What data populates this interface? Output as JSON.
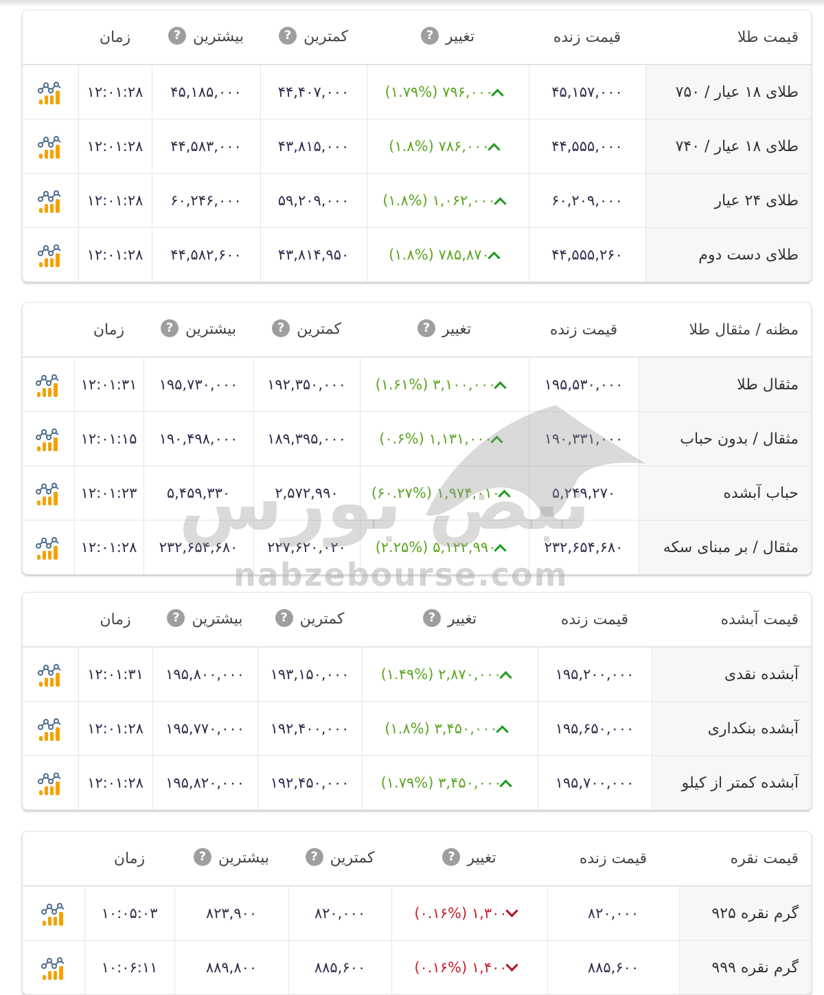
{
  "headers": {
    "live_price": "قیمت زنده",
    "change": "تغییر",
    "lowest": "کمترین",
    "highest": "بیشترین",
    "time": "زمان",
    "help_glyph": "?"
  },
  "watermark": {
    "site": "nabzebourse.com",
    "logo_text": "نبض بورس"
  },
  "colors": {
    "up": "#5aa51e",
    "down": "#c81e2a",
    "chart_icon_bars": "#f5a100",
    "chart_icon_line": "#4a6a8a"
  },
  "sections": [
    {
      "title": "قیمت طلا",
      "rows": [
        {
          "name": "طلای ۱۸ عیار / ۷۵۰",
          "live": "۴۵,۱۵۷,۰۰۰",
          "change": "۷۹۶,۰۰۰ (۱.۷۹%)",
          "direction": "up",
          "low": "۴۴,۴۰۷,۰۰۰",
          "high": "۴۵,۱۸۵,۰۰۰",
          "time": "۱۲:۰۱:۲۸"
        },
        {
          "name": "طلای ۱۸ عیار / ۷۴۰",
          "live": "۴۴,۵۵۵,۰۰۰",
          "change": "۷۸۶,۰۰۰ (۱.۸%)",
          "direction": "up",
          "low": "۴۳,۸۱۵,۰۰۰",
          "high": "۴۴,۵۸۳,۰۰۰",
          "time": "۱۲:۰۱:۲۸"
        },
        {
          "name": "طلای ۲۴ عیار",
          "live": "۶۰,۲۰۹,۰۰۰",
          "change": "۱,۰۶۲,۰۰۰ (۱.۸%)",
          "direction": "up",
          "low": "۵۹,۲۰۹,۰۰۰",
          "high": "۶۰,۲۴۶,۰۰۰",
          "time": "۱۲:۰۱:۲۸"
        },
        {
          "name": "طلای دست دوم",
          "live": "۴۴,۵۵۵,۲۶۰",
          "change": "۷۸۵,۸۷۰ (۱.۸%)",
          "direction": "up",
          "low": "۴۳,۸۱۴,۹۵۰",
          "high": "۴۴,۵۸۲,۶۰۰",
          "time": "۱۲:۰۱:۲۸"
        }
      ]
    },
    {
      "title": "مظنه / مثقال طلا",
      "rows": [
        {
          "name": "مثقال طلا",
          "live": "۱۹۵,۵۳۰,۰۰۰",
          "change": "۳,۱۰۰,۰۰۰ (۱.۶۱%)",
          "direction": "up",
          "low": "۱۹۲,۳۵۰,۰۰۰",
          "high": "۱۹۵,۷۳۰,۰۰۰",
          "time": "۱۲:۰۱:۳۱"
        },
        {
          "name": "مثقال / بدون حباب",
          "live": "۱۹۰,۳۳۱,۰۰۰",
          "change": "۱,۱۳۱,۰۰۰ (۰.۶%)",
          "direction": "up",
          "low": "۱۸۹,۳۹۵,۰۰۰",
          "high": "۱۹۰,۴۹۸,۰۰۰",
          "time": "۱۲:۰۱:۱۵"
        },
        {
          "name": "حباب آبشده",
          "live": "۵,۲۴۹,۲۷۰",
          "change": "۱,۹۷۴,۰۱۰ (۶۰.۲۷%)",
          "direction": "up",
          "low": "۲,۵۷۲,۹۹۰",
          "high": "۵,۴۵۹,۳۳۰",
          "time": "۱۲:۰۱:۲۳"
        },
        {
          "name": "مثقال / بر مبنای سکه",
          "live": "۲۳۲,۶۵۴,۶۸۰",
          "change": "۵,۱۲۲,۹۹۰ (۲.۲۵%)",
          "direction": "up",
          "low": "۲۲۷,۶۲۰,۰۲۰",
          "high": "۲۳۲,۶۵۴,۶۸۰",
          "time": "۱۲:۰۱:۲۸"
        }
      ]
    },
    {
      "title": "قیمت آبشده",
      "rows": [
        {
          "name": "آبشده نقدی",
          "live": "۱۹۵,۲۰۰,۰۰۰",
          "change": "۲,۸۷۰,۰۰۰ (۱.۴۹%)",
          "direction": "up",
          "low": "۱۹۳,۱۵۰,۰۰۰",
          "high": "۱۹۵,۸۰۰,۰۰۰",
          "time": "۱۲:۰۱:۳۱"
        },
        {
          "name": "آبشده بنکداری",
          "live": "۱۹۵,۶۵۰,۰۰۰",
          "change": "۳,۴۵۰,۰۰۰ (۱.۸%)",
          "direction": "up",
          "low": "۱۹۲,۴۰۰,۰۰۰",
          "high": "۱۹۵,۷۷۰,۰۰۰",
          "time": "۱۲:۰۱:۲۸"
        },
        {
          "name": "آبشده کمتر از کیلو",
          "live": "۱۹۵,۷۰۰,۰۰۰",
          "change": "۳,۴۵۰,۰۰۰ (۱.۷۹%)",
          "direction": "up",
          "low": "۱۹۲,۴۵۰,۰۰۰",
          "high": "۱۹۵,۸۲۰,۰۰۰",
          "time": "۱۲:۰۱:۲۸"
        }
      ]
    },
    {
      "title": "قیمت نقره",
      "rows": [
        {
          "name": "گرم نقره ۹۲۵",
          "live": "۸۲۰,۰۰۰",
          "change": "۱,۳۰۰ (۰.۱۶%)",
          "direction": "down",
          "low": "۸۲۰,۰۰۰",
          "high": "۸۲۳,۹۰۰",
          "time": "۱۰:۰۵:۰۳"
        },
        {
          "name": "گرم نقره ۹۹۹",
          "live": "۸۸۵,۶۰۰",
          "change": "۱,۴۰۰ (۰.۱۶%)",
          "direction": "down",
          "low": "۸۸۵,۶۰۰",
          "high": "۸۸۹,۸۰۰",
          "time": "۱۰:۰۶:۱۱"
        }
      ]
    }
  ]
}
